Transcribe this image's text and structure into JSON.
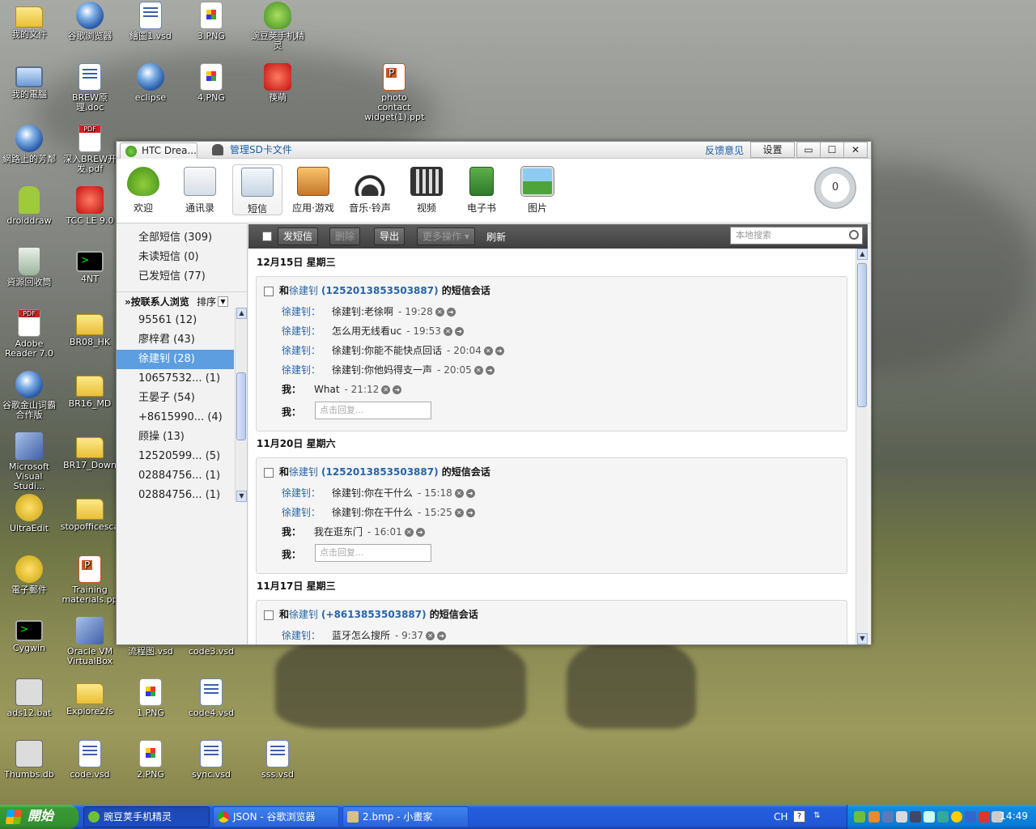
{
  "desktop": {
    "icons": [
      {
        "label": "我的文件"
      },
      {
        "label": "谷歌浏览器"
      },
      {
        "label": "繪圖1.vsd"
      },
      {
        "label": "3.PNG"
      },
      {
        "label": "豌豆荚手机精灵"
      },
      {
        "label": "我的電腦"
      },
      {
        "label": "BREW原理.doc"
      },
      {
        "label": "eclipse"
      },
      {
        "label": "4.PNG"
      },
      {
        "label": "筷萌"
      },
      {
        "label": "photo contact widget(1).ppt"
      },
      {
        "label": "網路上的芳鄰"
      },
      {
        "label": "深入BREW开发.pdf"
      },
      {
        "label": "droiddraw"
      },
      {
        "label": "TCC LE 9.0"
      },
      {
        "label": "資源回收筒"
      },
      {
        "label": "4NT"
      },
      {
        "label": "Adobe Reader 7.0"
      },
      {
        "label": "BR08_HK"
      },
      {
        "label": "谷歌金山词霸合作版"
      },
      {
        "label": "BR16_MD"
      },
      {
        "label": "Microsoft Visual Studi..."
      },
      {
        "label": "BR17_Down"
      },
      {
        "label": "UltraEdit"
      },
      {
        "label": "stopofficesca"
      },
      {
        "label": "電子郵件"
      },
      {
        "label": "Training materials.pp"
      },
      {
        "label": "Cygwin"
      },
      {
        "label": "Oracle VM VirtualBox"
      },
      {
        "label": "流程图.vsd"
      },
      {
        "label": "code3.vsd"
      },
      {
        "label": "ads12.bat"
      },
      {
        "label": "Explore2fs"
      },
      {
        "label": "1.PNG"
      },
      {
        "label": "code4.vsd"
      },
      {
        "label": "Thumbs.db"
      },
      {
        "label": "code.vsd"
      },
      {
        "label": "2.PNG"
      },
      {
        "label": "sync.vsd"
      },
      {
        "label": "sss.vsd"
      }
    ]
  },
  "window": {
    "tabs": [
      {
        "label": "HTC Drea..."
      },
      {
        "label": "管理SD卡文件"
      }
    ],
    "feedback": "反馈意见",
    "settings": "设置",
    "controls": {
      "min": "▭",
      "max": "☐",
      "close": "✕"
    }
  },
  "toolbar": {
    "items": [
      {
        "label": "欢迎"
      },
      {
        "label": "通讯录"
      },
      {
        "label": "短信"
      },
      {
        "label": "应用·游戏"
      },
      {
        "label": "音乐·铃声"
      },
      {
        "label": "视频"
      },
      {
        "label": "电子书"
      },
      {
        "label": "图片"
      }
    ],
    "active": "短信",
    "progress": "0"
  },
  "sidebar": {
    "folders": [
      {
        "label": "全部短信 (309)"
      },
      {
        "label": "未读短信 (0)"
      },
      {
        "label": "已发短信 (77)"
      }
    ],
    "contacts_header": "»按联系人浏览",
    "sort": "排序",
    "contacts": [
      {
        "label": "95561 (12)"
      },
      {
        "label": "廖梓君 (43)"
      },
      {
        "label": "徐建钊 (28)"
      },
      {
        "label": "10657532...   (1)"
      },
      {
        "label": "王晏子 (54)"
      },
      {
        "label": "+8615990...   (4)"
      },
      {
        "label": "顾操 (13)"
      },
      {
        "label": "12520599...   (5)"
      },
      {
        "label": "02884756...   (1)"
      },
      {
        "label": "02884756...   (1)"
      }
    ],
    "selected": "徐建钊 (28)"
  },
  "opbar": {
    "send": "发短信",
    "delete": "删除",
    "export": "导出",
    "more": "更多操作 ▾",
    "refresh": "刷新",
    "search_placeholder": "本地搜索"
  },
  "conversations": [
    {
      "date": "12月15日 星期三",
      "title_prefix": "和",
      "contact": "徐建钊",
      "phone": "(1252013853503887)",
      "title_suffix": " 的短信会话",
      "messages": [
        {
          "who": "徐建钊：",
          "text": "徐建钊:老徐啊",
          "time": "- 19:28"
        },
        {
          "who": "徐建钊：",
          "text": "怎么用无线看uc",
          "time": "- 19:53"
        },
        {
          "who": "徐建钊：",
          "text": "徐建钊:你能不能快点回话",
          "time": "- 20:04"
        },
        {
          "who": "徐建钊：",
          "text": "徐建钊:你他妈得支一声",
          "time": "- 20:05"
        },
        {
          "who": "我：",
          "text": "What",
          "time": "- 21:12"
        }
      ],
      "reply_label": "我：",
      "reply_placeholder": "点击回复..."
    },
    {
      "date": "11月20日 星期六",
      "title_prefix": "和",
      "contact": "徐建钊",
      "phone": "(1252013853503887)",
      "title_suffix": " 的短信会话",
      "messages": [
        {
          "who": "徐建钊：",
          "text": "徐建钊:你在干什么",
          "time": "- 15:18"
        },
        {
          "who": "徐建钊：",
          "text": "徐建钊:你在干什么",
          "time": "- 15:25"
        },
        {
          "who": "我：",
          "text": "我在逛东门",
          "time": "- 16:01"
        }
      ],
      "reply_label": "我：",
      "reply_placeholder": "点击回复..."
    },
    {
      "date": "11月17日 星期三",
      "title_prefix": "和",
      "contact": "徐建钊",
      "phone": "(+8613853503887)",
      "title_suffix": " 的短信会话",
      "messages": [
        {
          "who": "徐建钊：",
          "text": "蓝牙怎么搜所",
          "time": "- 9:37"
        }
      ]
    }
  ],
  "taskbar": {
    "start": "開始",
    "tasks": [
      {
        "label": "豌豆荚手机精灵"
      },
      {
        "label": "JSON - 谷歌浏览器"
      },
      {
        "label": "2.bmp - 小畫家"
      }
    ],
    "lang": "CH",
    "clock": "14:49"
  }
}
